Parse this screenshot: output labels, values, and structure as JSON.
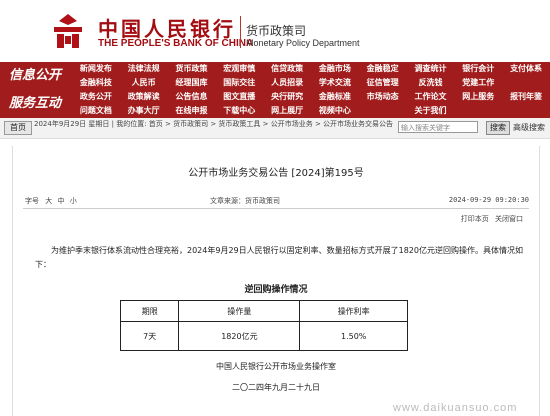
{
  "header": {
    "bank_name_cn": "中国人民银行",
    "bank_name_en": "THE PEOPLE'S BANK OF CHINA",
    "dept_cn": "货币政策司",
    "dept_en": "Monetary Policy Department"
  },
  "nav": {
    "section1": "信息公开",
    "section2": "服务互动",
    "rows": [
      [
        "新闻发布",
        "法律法规",
        "货币政策",
        "宏观审慎",
        "信贷政策",
        "金融市场",
        "金融稳定",
        "调查统计",
        "银行会计",
        "支付体系"
      ],
      [
        "金融科技",
        "人民币",
        "经理国库",
        "国际交往",
        "人员招录",
        "学术交流",
        "征信管理",
        "反洗钱",
        "党建工作",
        ""
      ],
      [
        "政务公开",
        "政策解读",
        "公告信息",
        "图文直播",
        "央行研究",
        "金融标准",
        "市场动态",
        "工作论文",
        "网上服务",
        "报刊年鉴"
      ],
      [
        "问题文档",
        "办事大厅",
        "在线申报",
        "下载中心",
        "网上展厅",
        "视频中心",
        "",
        "关于我们",
        "",
        ""
      ]
    ]
  },
  "breadcrumb": {
    "home": "首页",
    "text": "2024年9月29日 星期日 | 我的位置: 首页 > 货币政策司 > 货币政策工具 > 公开市场业务 > 公开市场业务交易公告",
    "search_placeholder": "输入搜索关键字",
    "search_button": "搜索",
    "advanced": "高级搜索"
  },
  "article": {
    "title": "公开市场业务交易公告 [2024]第195号",
    "font_size_label": "字号",
    "font_large": "大",
    "font_medium": "中",
    "font_small": "小",
    "source": "文章来源：货币政策司",
    "date": "2024-09-29 09:20:30",
    "print": "打印本页",
    "close": "关闭窗口",
    "paragraph": "为维护季末银行体系流动性合理充裕，2024年9月29日人民银行以固定利率、数量招标方式开展了1820亿元逆回购操作。具体情况如下：",
    "table_title": "逆回购操作情况",
    "table_headers": [
      "期限",
      "操作量",
      "操作利率"
    ],
    "table_rows": [
      [
        "7天",
        "1820亿元",
        "1.50%"
      ]
    ],
    "signature": "中国人民银行公开市场业务操作室",
    "sign_date": "二〇二四年九月二十九日"
  },
  "watermark": "www.daikuansuo.com"
}
